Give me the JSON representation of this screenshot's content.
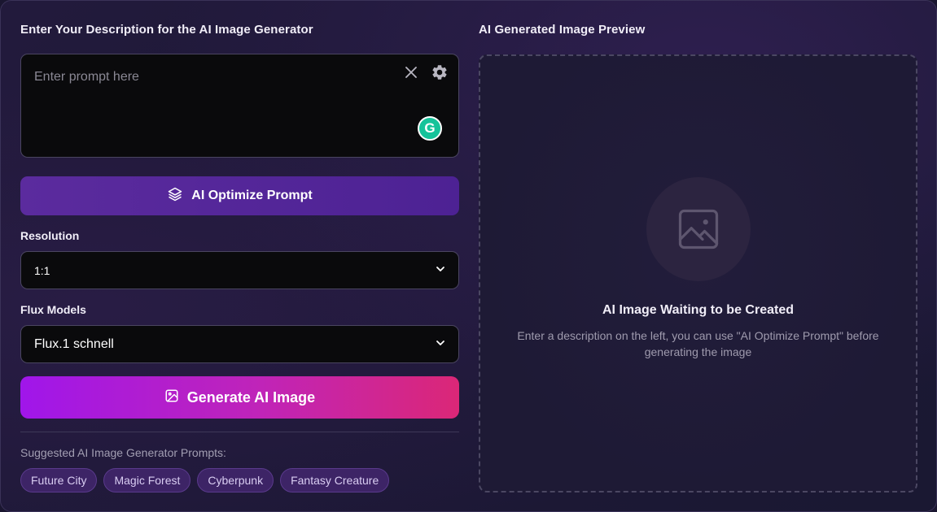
{
  "left": {
    "title": "Enter Your Description for the AI Image Generator",
    "prompt": {
      "placeholder": "Enter prompt here",
      "value": "",
      "clear_icon": "close-icon",
      "settings_icon": "gear-icon",
      "grammarly_letter": "G"
    },
    "optimize_button": {
      "label": "AI Optimize Prompt",
      "icon": "layers-icon"
    },
    "resolution": {
      "label": "Resolution",
      "selected": "1:1"
    },
    "models": {
      "label": "Flux Models",
      "selected": "Flux.1 schnell"
    },
    "generate_button": {
      "label": "Generate AI Image",
      "icon": "image-icon"
    },
    "suggestions": {
      "label": "Suggested AI Image Generator Prompts:",
      "items": [
        "Future City",
        "Magic Forest",
        "Cyberpunk",
        "Fantasy Creature"
      ]
    }
  },
  "right": {
    "title": "AI Generated Image Preview",
    "empty_state": {
      "icon": "image-placeholder-icon",
      "title": "AI Image Waiting to be Created",
      "description": "Enter a description on the left, you can use \"AI Optimize Prompt\" before generating the image"
    }
  },
  "colors": {
    "accent_purple": "#5b2b9e",
    "generate_gradient_start": "#a016ea",
    "generate_gradient_end": "#db2777",
    "chip_bg": "#3d2466",
    "grammarly_green": "#15c39a"
  }
}
